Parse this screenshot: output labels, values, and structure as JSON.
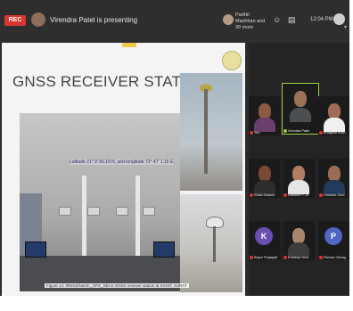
{
  "topbar": {
    "rec_label": "REC",
    "presenting_text": "Virendra Patel is presenting",
    "viewers_text": "Parthil Machhan and 39 more",
    "time": "12:04 PM"
  },
  "slide": {
    "title": "GNSS RECEIVER STATION",
    "coordinates": "Latitude 21° 9' 56.19 N, and longitude 72° 47' 1.15 E",
    "caption": "Figure 14: IRNSS/NavIC_GPS_SBAS GNSS receiver station at SVNIT, SURAT"
  },
  "participants": [
    {
      "name": "You",
      "avatar": "face",
      "face": "#8a5a44",
      "body": "#6b3f6b"
    },
    {
      "name": "Virendra Patel",
      "avatar": "face",
      "face": "#9c7257",
      "body": "#4b4f52"
    },
    {
      "name": "Bhagwat Kuch",
      "avatar": "face",
      "face": "#a06c55",
      "body": "#f0f0f0"
    },
    {
      "name": "Shital Solanki",
      "avatar": "face",
      "face": "#7a4a36",
      "body": "#2e2e2e"
    },
    {
      "name": "Darshan P Jo",
      "avatar": "face",
      "face": "#b07d62",
      "body": "#e5e5e5"
    },
    {
      "name": "Hrushek Gore",
      "avatar": "face",
      "face": "#9b6d57",
      "body": "#243a5a"
    },
    {
      "name": "Keyur Prajapati",
      "avatar": "initial",
      "initial": "K",
      "color": "#6a4fb3"
    },
    {
      "name": "Kuldeep Vora",
      "avatar": "face",
      "face": "#a7876b",
      "body": "#3c3c3c"
    },
    {
      "name": "Parmar Chirag",
      "avatar": "initial",
      "initial": "P",
      "color": "#5065c4"
    }
  ]
}
